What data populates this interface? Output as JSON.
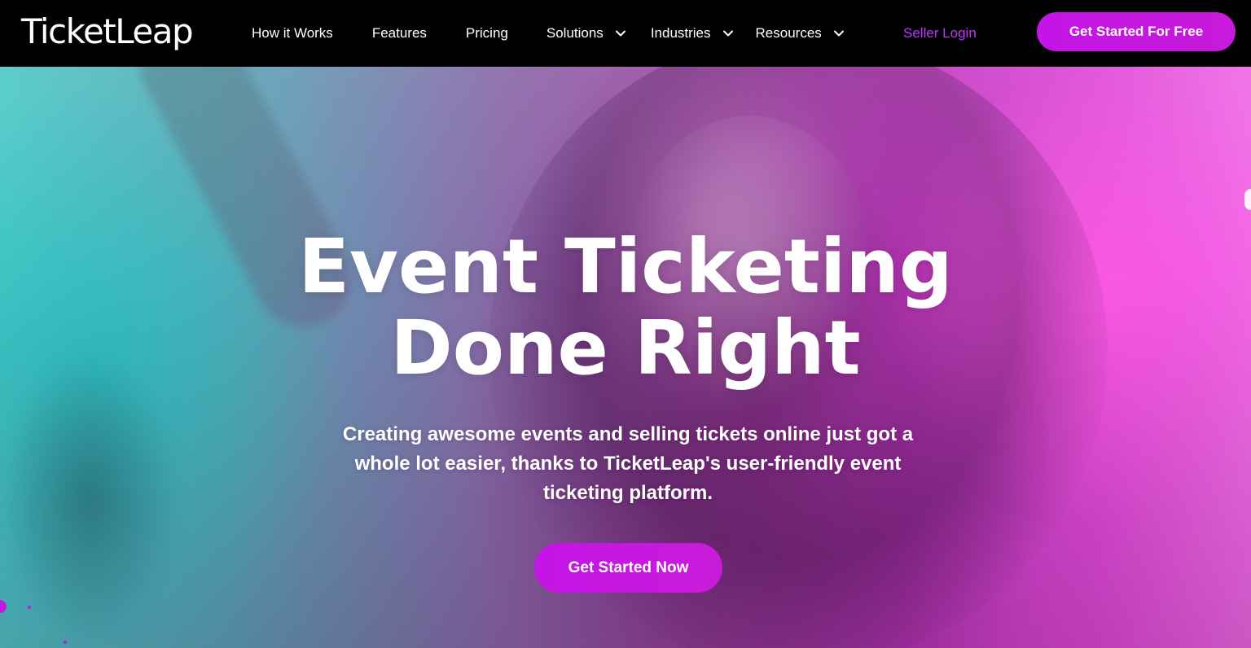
{
  "brand": {
    "logo_text": "TicketLeap"
  },
  "nav": {
    "items": [
      {
        "label": "How it Works",
        "has_dropdown": false
      },
      {
        "label": "Features",
        "has_dropdown": false
      },
      {
        "label": "Pricing",
        "has_dropdown": false
      },
      {
        "label": "Solutions",
        "has_dropdown": true
      },
      {
        "label": "Industries",
        "has_dropdown": true
      },
      {
        "label": "Resources",
        "has_dropdown": true
      }
    ],
    "seller_login": "Seller Login",
    "cta": "Get Started For Free"
  },
  "hero": {
    "headline_line1": "Event Ticketing",
    "headline_line2": "Done Right",
    "subtext": "Creating awesome events and selling tickets online just got a whole lot easier, thanks to TicketLeap's user-friendly event ticketing platform.",
    "cta": "Get Started Now"
  },
  "colors": {
    "accent": "#c218e0",
    "seller_login": "#c236ff",
    "nav_background": "#000000"
  },
  "icons": {
    "dropdown": "chevron-down-icon"
  }
}
